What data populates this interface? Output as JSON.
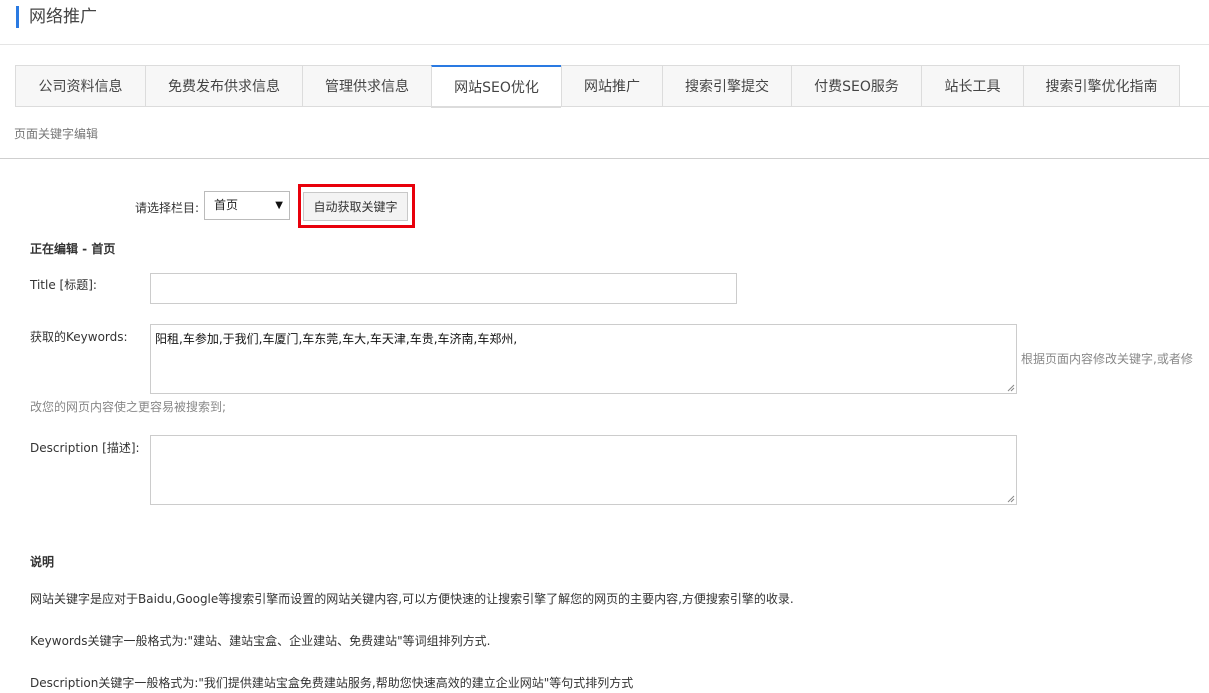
{
  "header": {
    "title": "网络推广"
  },
  "tabs": [
    {
      "label": "公司资料信息",
      "active": false
    },
    {
      "label": "免费发布供求信息",
      "active": false
    },
    {
      "label": "管理供求信息",
      "active": false
    },
    {
      "label": "网站SEO优化",
      "active": true
    },
    {
      "label": "网站推广",
      "active": false
    },
    {
      "label": "搜索引擎提交",
      "active": false
    },
    {
      "label": "付费SEO服务",
      "active": false
    },
    {
      "label": "站长工具",
      "active": false
    },
    {
      "label": "搜索引擎优化指南",
      "active": false
    }
  ],
  "section": {
    "subtitle": "页面关键字编辑"
  },
  "form": {
    "column_label": "请选择栏目:",
    "column_selected": "首页",
    "auto_button_label": "自动获取关键字",
    "editing_label": "正在编辑 - 首页",
    "title_label": "Title [标题]:",
    "title_value": "",
    "keywords_label": "获取的Keywords:",
    "keywords_value": "阳租,车参加,于我们,车厦门,车东莞,车大,车天津,车贵,车济南,车郑州,",
    "keywords_hint_1": "根据页面内容修改关键字,或者修",
    "keywords_hint_2": "改您的网页内容使之更容易被搜索到;",
    "description_label": "Description [描述]:",
    "description_value": ""
  },
  "notes": {
    "title": "说明",
    "line1": "网站关键字是应对于Baidu,Google等搜索引擎而设置的网站关键内容,可以方便快速的让搜索引擎了解您的网页的主要内容,方便搜索引擎的收录.",
    "line2": "Keywords关键字一般格式为:\"建站、建站宝盒、企业建站、免费建站\"等词组排列方式.",
    "line3": "Description关键字一般格式为:\"我们提供建站宝盒免费建站服务,帮助您快速高效的建立企业网站\"等句式排列方式"
  },
  "colors": {
    "accent": "#2a7ae2",
    "highlight": "#e8000b"
  }
}
